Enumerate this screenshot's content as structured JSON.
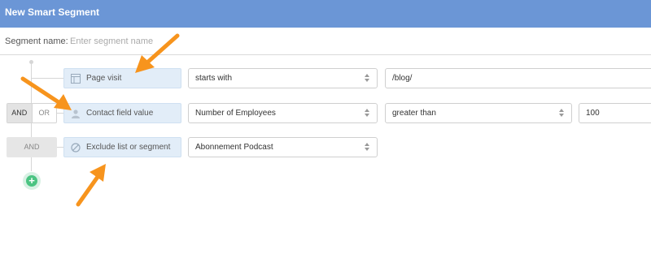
{
  "window": {
    "title": "New Smart Segment"
  },
  "segment_name": {
    "label": "Segment name:",
    "placeholder": "Enter segment name",
    "value": ""
  },
  "operators": {
    "and": "AND",
    "or": "OR",
    "selected": "AND",
    "static": "AND"
  },
  "rows": [
    {
      "condition": "Page visit",
      "icon": "page-icon",
      "operator": "starts with",
      "value": "/blog/"
    },
    {
      "condition": "Contact field value",
      "icon": "person-icon",
      "field": "Number of Employees",
      "operator": "greater than",
      "value": "100"
    },
    {
      "condition": "Exclude list or segment",
      "icon": "no-entry-icon",
      "list": "Abonnement Podcast"
    }
  ],
  "add_button": {
    "icon": "plus-icon"
  },
  "colors": {
    "titlebar": "#6b96d6",
    "condition_bg": "#e2edf8",
    "add_green": "#4bc482",
    "annotation_arrow": "#f7941d"
  }
}
